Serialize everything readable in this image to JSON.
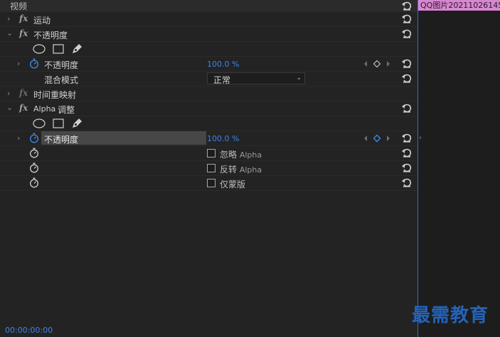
{
  "header": {
    "title": "视频"
  },
  "timeline": {
    "clip_label": "QQ图片20211026145"
  },
  "effects": {
    "motion": {
      "label": "运动"
    },
    "opacity": {
      "label": "不透明度",
      "param_label": "不透明度",
      "value": "100.0 %",
      "blend_label": "混合模式",
      "blend_value": "正常"
    },
    "time_remap": {
      "label": "时间重映射"
    },
    "alpha_adjust": {
      "label_en": "Alpha",
      "label_cn": "调整",
      "param_label": "不透明度",
      "value": "100.0 %",
      "ignore_alpha": {
        "label_cn": "忽略",
        "label_en": "Alpha",
        "checked": false
      },
      "invert_alpha": {
        "label_cn": "反转",
        "label_en": "Alpha",
        "checked": false
      },
      "mask_only": {
        "label": "仅蒙版",
        "checked": false
      }
    }
  },
  "status": {
    "timecode": "00:00:00:00"
  },
  "watermark": {
    "text": "最需教育"
  },
  "colors": {
    "accent": "#3b86e6",
    "selection_line": "#2d6fd6",
    "clip_label_bg": "#d986d2",
    "watermark": "#2463b7"
  }
}
